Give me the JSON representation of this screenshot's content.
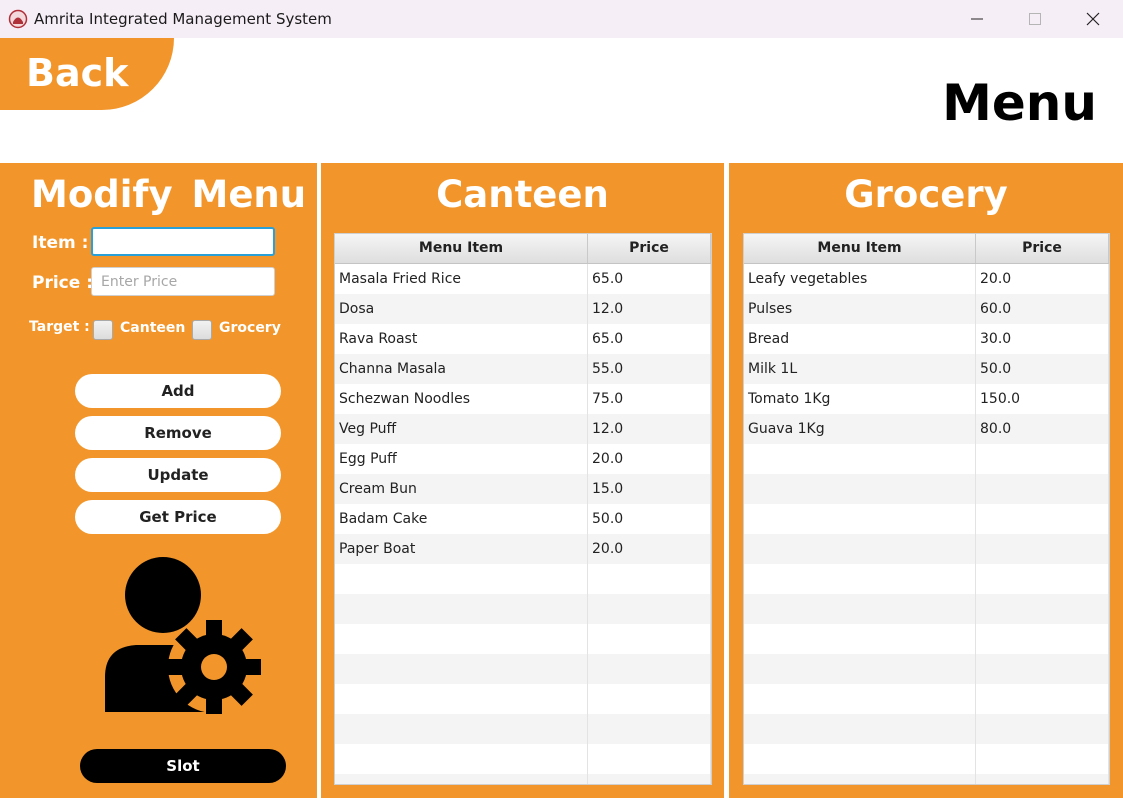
{
  "window": {
    "title": "Amrita Integrated Management System"
  },
  "header": {
    "back_label": "Back",
    "page_title": "Menu"
  },
  "modify": {
    "heading": "Modify  Menu",
    "item_label": "Item :",
    "item_value": "",
    "price_label": "Price :",
    "price_placeholder": "Enter Price",
    "target_label": "Target :",
    "canteen_label": "Canteen",
    "grocery_label": "Grocery",
    "add_label": "Add",
    "remove_label": "Remove",
    "update_label": "Update",
    "get_price_label": "Get Price",
    "slot_label": "Slot"
  },
  "canteen": {
    "heading": "Canteen",
    "columns": [
      "Menu Item",
      "Price"
    ],
    "rows": [
      [
        "Masala Fried Rice",
        "65.0"
      ],
      [
        "Dosa",
        "12.0"
      ],
      [
        "Rava Roast",
        "65.0"
      ],
      [
        "Channa Masala",
        "55.0"
      ],
      [
        "Schezwan Noodles",
        "75.0"
      ],
      [
        "Veg Puff",
        "12.0"
      ],
      [
        "Egg Puff",
        "20.0"
      ],
      [
        "Cream Bun",
        "15.0"
      ],
      [
        "Badam Cake",
        "50.0"
      ],
      [
        "Paper Boat",
        "20.0"
      ]
    ]
  },
  "grocery": {
    "heading": "Grocery",
    "columns": [
      "Menu Item",
      "Price"
    ],
    "rows": [
      [
        "Leafy vegetables",
        "20.0"
      ],
      [
        "Pulses",
        "60.0"
      ],
      [
        "Bread",
        "30.0"
      ],
      [
        "Milk 1L",
        "50.0"
      ],
      [
        "Tomato 1Kg",
        "150.0"
      ],
      [
        "Guava 1Kg",
        "80.0"
      ]
    ]
  },
  "colors": {
    "accent": "#f2962b",
    "focus": "#2aa0d8"
  },
  "icons": {
    "app": "amrita-logo-icon",
    "user_settings": "user-gear-icon"
  }
}
